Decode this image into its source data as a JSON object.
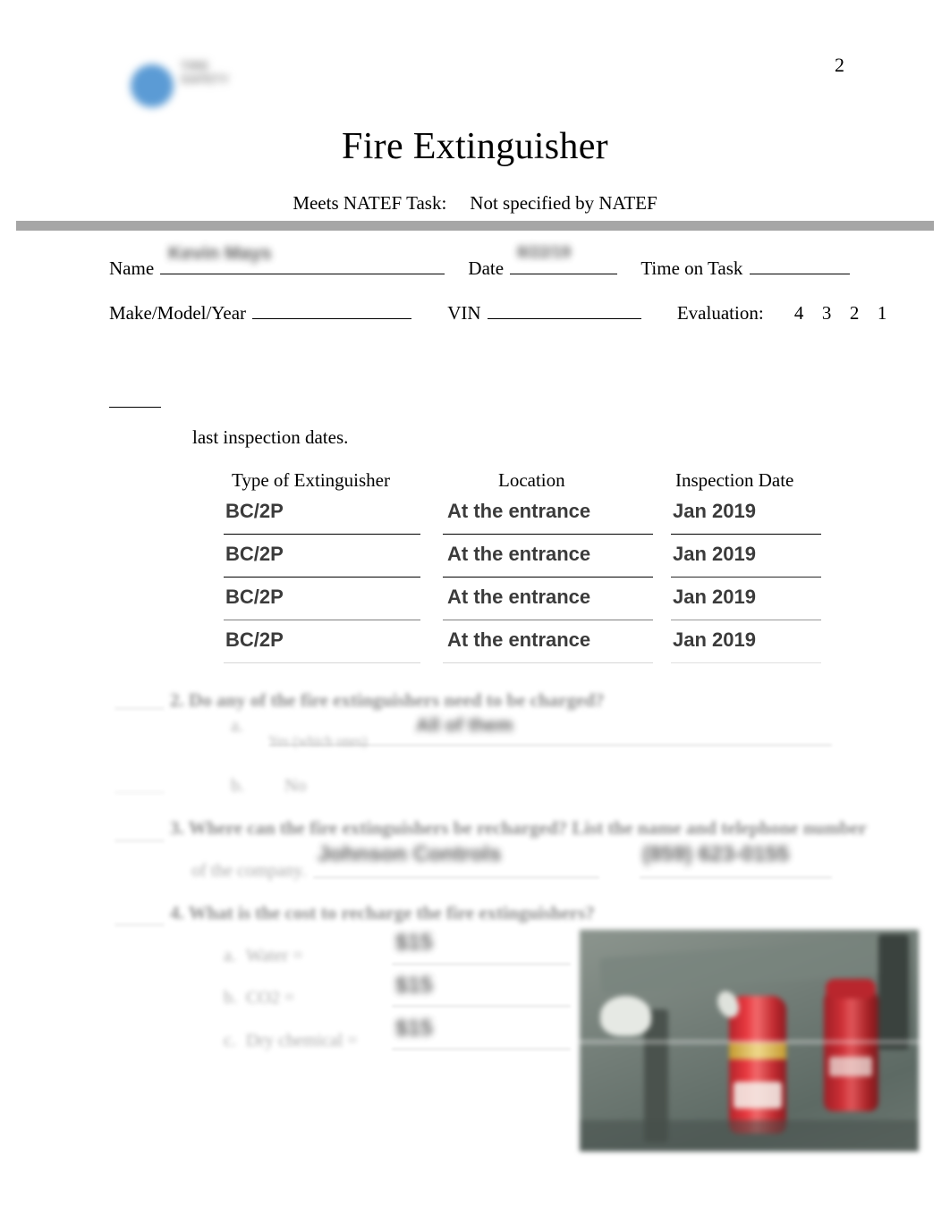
{
  "document": {
    "page_number": "2",
    "title": "Fire Extinguisher",
    "natef_label": "Meets NATEF Task:",
    "natef_value": "Not specified by NATEF",
    "logo_wordmark": "TIRE SAFETY"
  },
  "identity": {
    "name_label": "Name",
    "name_value": "Kevin Mays",
    "date_label": "Date",
    "date_value": "8/22/19",
    "time_on_task_label": "Time on Task",
    "time_on_task_value": "",
    "make_model_year_label": "Make/Model/Year",
    "make_model_year_value": "",
    "vin_label": "VIN",
    "vin_value": "",
    "evaluation_label": "Evaluation:",
    "evaluation_options": [
      "4",
      "3",
      "2",
      "1"
    ]
  },
  "instructions": {
    "text": "last inspection dates."
  },
  "table": {
    "headers": [
      "Type of Extinguisher",
      "Location",
      "Inspection Date"
    ],
    "rows": [
      {
        "type": "BC/2P",
        "location": "At the entrance",
        "date": "Jan 2019"
      },
      {
        "type": "BC/2P",
        "location": "At the entrance",
        "date": "Jan 2019"
      },
      {
        "type": "BC/2P",
        "location": "At the entrance",
        "date": "Jan 2019"
      },
      {
        "type": "BC/2P",
        "location": "At the entrance",
        "date": "Jan 2019"
      }
    ]
  },
  "questions": [
    {
      "number": "2.",
      "text": "Do any of the fire extinguishers need to be charged?",
      "sub": [
        {
          "label": "a.",
          "text": "Yes (which ones)",
          "answer": "All of them"
        },
        {
          "label": "b.",
          "text": "No",
          "answer": ""
        }
      ]
    },
    {
      "number": "3.",
      "text": "Where can the fire extinguishers be recharged?  List the name and telephone number",
      "continuation": "of the company.",
      "answer_company": "Johnson Controls",
      "answer_phone": "(859) 623-0155"
    },
    {
      "number": "4.",
      "text": "What is the cost to recharge the fire extinguishers?",
      "sub": [
        {
          "label": "a.",
          "text": "Water =",
          "answer": "$15"
        },
        {
          "label": "b.",
          "text": "CO2 =",
          "answer": "$15"
        },
        {
          "label": "c.",
          "text": "Dry chemical =",
          "answer": "$15"
        }
      ]
    }
  ],
  "photo": {
    "caption": "fire-extinguishers-photo",
    "alt": "Two red fire extinguishers against a gray-green wall"
  },
  "colors": {
    "gray_bar": "#a6a6a6",
    "logo_blue": "#5b9bd5",
    "extinguisher_red": "#c22a30"
  }
}
